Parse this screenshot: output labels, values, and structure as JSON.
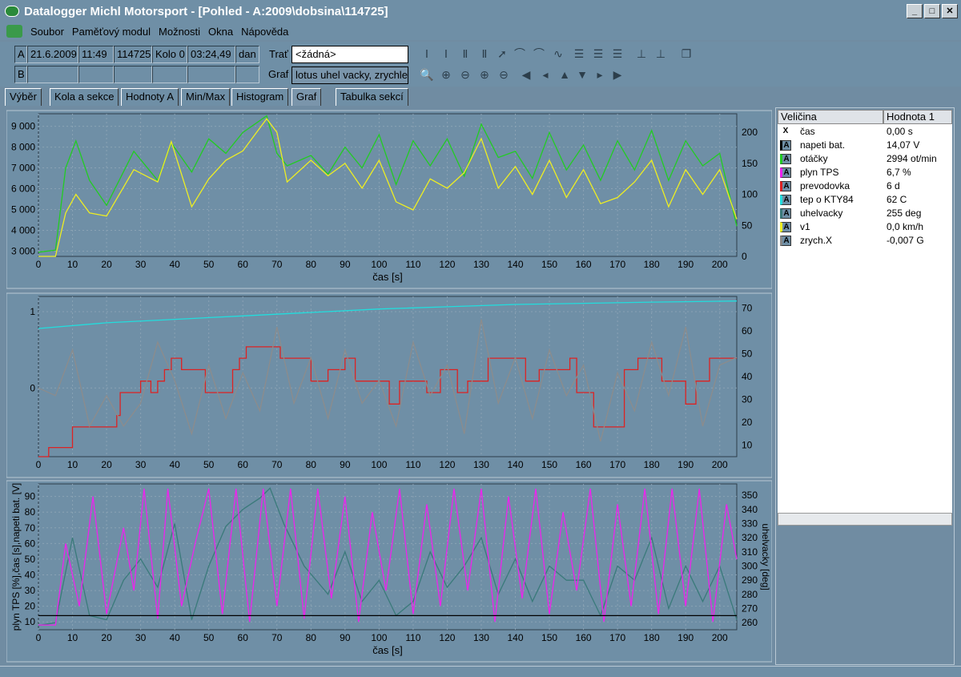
{
  "window": {
    "title": "Datalogger Michl Motorsport - [Pohled - A:2009\\dobsina\\114725]"
  },
  "menu": [
    "Soubor",
    "Paměťový modul",
    "Možnosti",
    "Okna",
    "Nápověda"
  ],
  "toolbar": {
    "rowA": {
      "tag": "A",
      "date": "21.6.2009",
      "time": "11:49",
      "file": "114725",
      "lap": "Kolo 0",
      "laptime": "03:24,49",
      "unit": "dan"
    },
    "rowB": {
      "tag": "B"
    },
    "trat_label": "Trať",
    "trat_value": "<žádná>",
    "graf_label": "Graf",
    "graf_value": "lotus uhel vacky, zrychle"
  },
  "tabs": [
    "Výběr",
    "Kola a sekce",
    "Hodnoty A",
    "Min/Max",
    "Histogram",
    "Graf",
    "Tabulka sekcí"
  ],
  "active_tab": "Graf",
  "channels": {
    "header": {
      "name": "Veličina",
      "value": "Hodnota 1"
    },
    "rows": [
      {
        "swatch": "X",
        "name": "čas",
        "value": "0,00 s",
        "color": "#ffffff"
      },
      {
        "swatch": "A",
        "name": "napeti bat.",
        "value": "14,07 V",
        "color": "#000000"
      },
      {
        "swatch": "A",
        "name": "otáčky",
        "value": "2994 ot/min",
        "color": "#22cc22"
      },
      {
        "swatch": "A",
        "name": "plyn TPS",
        "value": "6,7 %",
        "color": "#ee22ee"
      },
      {
        "swatch": "A",
        "name": "prevodovka",
        "value": "6 d",
        "color": "#dd2222"
      },
      {
        "swatch": "A",
        "name": "tep o KTY84",
        "value": "62 C",
        "color": "#22dddd"
      },
      {
        "swatch": "A",
        "name": "uhelvacky",
        "value": "255 deg",
        "color": "#3a7a7a"
      },
      {
        "swatch": "A",
        "name": "v1",
        "value": "0,0 km/h",
        "color": "#eeee22"
      },
      {
        "swatch": "A",
        "name": "zrych.X",
        "value": "-0,007 G",
        "color": "#888888"
      }
    ]
  },
  "colors": {
    "plot_bg": "#6f8fa6",
    "grid": "#8aa2b4"
  },
  "chart_data": [
    {
      "type": "line",
      "xlabel": "čas [s]",
      "xlim": [
        0,
        205
      ],
      "x_ticks": [
        0,
        10,
        20,
        30,
        40,
        50,
        60,
        70,
        80,
        90,
        100,
        110,
        120,
        130,
        140,
        150,
        160,
        170,
        180,
        190,
        200
      ],
      "y_left_ticks": [
        "3 000",
        "4 000",
        "5 000",
        "6 000",
        "7 000",
        "8 000",
        "9 000"
      ],
      "ylim_left": [
        2750,
        9600
      ],
      "y_right_ticks": [
        "0",
        "50",
        "100",
        "150",
        "200"
      ],
      "ylim_right": [
        0,
        230
      ],
      "series": [
        {
          "name": "otáčky",
          "axis": "left",
          "color": "#22cc22",
          "x": [
            0,
            5,
            8,
            11,
            15,
            20,
            28,
            35,
            39,
            45,
            50,
            55,
            60,
            67,
            70,
            73,
            80,
            85,
            90,
            95,
            100,
            105,
            110,
            115,
            120,
            125,
            130,
            135,
            140,
            145,
            150,
            155,
            160,
            165,
            170,
            175,
            180,
            185,
            190,
            195,
            200,
            205
          ],
          "y": [
            2950,
            3050,
            7000,
            8300,
            6400,
            5200,
            7800,
            6400,
            8200,
            6800,
            8400,
            7700,
            8700,
            9500,
            7700,
            7100,
            7600,
            6700,
            8000,
            7000,
            8600,
            6200,
            8300,
            7100,
            8400,
            6600,
            9100,
            7500,
            7800,
            6500,
            8700,
            6900,
            8100,
            6400,
            8300,
            6900,
            8800,
            6400,
            8300,
            7100,
            7700,
            4200
          ]
        },
        {
          "name": "v1",
          "axis": "right",
          "color": "#eeee22",
          "x": [
            0,
            5,
            8,
            11,
            15,
            20,
            28,
            35,
            39,
            45,
            50,
            55,
            60,
            67,
            70,
            73,
            80,
            85,
            90,
            95,
            100,
            105,
            110,
            115,
            120,
            125,
            130,
            135,
            140,
            145,
            150,
            155,
            160,
            165,
            170,
            175,
            180,
            185,
            190,
            195,
            200,
            205
          ],
          "y": [
            0,
            0,
            70,
            100,
            70,
            65,
            140,
            120,
            185,
            80,
            125,
            155,
            170,
            222,
            200,
            120,
            155,
            130,
            150,
            110,
            155,
            88,
            75,
            125,
            110,
            135,
            190,
            110,
            145,
            100,
            155,
            95,
            140,
            85,
            95,
            120,
            155,
            80,
            140,
            100,
            140,
            60
          ]
        }
      ]
    },
    {
      "type": "line",
      "xlim": [
        0,
        205
      ],
      "x_ticks": [
        0,
        10,
        20,
        30,
        40,
        50,
        60,
        70,
        80,
        90,
        100,
        110,
        120,
        130,
        140,
        150,
        160,
        170,
        180,
        190,
        200
      ],
      "y_left_ticks": [
        "0",
        "1"
      ],
      "ylim_left": [
        -0.9,
        1.2
      ],
      "y_right_ticks": [
        "10",
        "20",
        "30",
        "40",
        "50",
        "60",
        "70"
      ],
      "ylim_right": [
        5,
        75
      ],
      "series": [
        {
          "name": "tep o KTY84",
          "axis": "right",
          "color": "#22dddd",
          "x": [
            0,
            20,
            40,
            60,
            80,
            100,
            120,
            140,
            160,
            180,
            205
          ],
          "y": [
            61,
            63.5,
            65,
            66.5,
            68,
            69.5,
            70.5,
            71.5,
            72,
            72.5,
            73
          ]
        },
        {
          "name": "prevodovka",
          "axis": "right",
          "color": "#dd2222",
          "x": [
            0,
            3,
            3,
            10,
            10,
            20,
            20,
            23,
            23,
            24,
            24,
            30,
            30,
            33,
            33,
            35,
            35,
            37,
            37,
            39,
            39,
            42,
            42,
            49,
            49,
            57,
            57,
            59,
            59,
            61,
            61,
            71,
            71,
            80,
            80,
            85,
            85,
            90,
            90,
            93,
            93,
            103,
            103,
            106,
            106,
            114,
            114,
            118,
            118,
            123,
            123,
            126,
            126,
            132,
            132,
            143,
            143,
            147,
            147,
            156,
            156,
            158,
            158,
            163,
            163,
            172,
            172,
            176,
            176,
            183,
            183,
            190,
            190,
            193,
            193,
            197,
            197,
            205
          ],
          "y": [
            5,
            5,
            9,
            9,
            18,
            18,
            18,
            18,
            23,
            23,
            33,
            33,
            38,
            38,
            33,
            33,
            38,
            38,
            43,
            43,
            48,
            48,
            43,
            43,
            33,
            33,
            43,
            43,
            48,
            48,
            53,
            53,
            48,
            48,
            38,
            38,
            43,
            43,
            48,
            48,
            38,
            38,
            28,
            28,
            38,
            38,
            33,
            33,
            43,
            43,
            33,
            33,
            38,
            38,
            48,
            48,
            38,
            38,
            43,
            43,
            48,
            48,
            33,
            33,
            18,
            18,
            43,
            43,
            48,
            48,
            38,
            38,
            28,
            28,
            38,
            38,
            48,
            48
          ]
        },
        {
          "name": "zrych.X",
          "axis": "left",
          "color": "#8c8c8c",
          "x": [
            0,
            5,
            10,
            15,
            20,
            25,
            30,
            35,
            40,
            45,
            50,
            55,
            60,
            65,
            70,
            75,
            80,
            85,
            90,
            95,
            100,
            105,
            110,
            115,
            120,
            125,
            130,
            135,
            140,
            145,
            150,
            155,
            160,
            165,
            170,
            175,
            180,
            185,
            190,
            195,
            200,
            205
          ],
          "y": [
            0,
            -0.1,
            0.5,
            -0.5,
            -0.1,
            -0.5,
            -0.2,
            0.6,
            0.1,
            -0.6,
            0.3,
            -0.4,
            0.2,
            -0.3,
            0.8,
            -0.2,
            0.4,
            -0.4,
            0.5,
            -0.2,
            0.1,
            -0.5,
            0.6,
            -0.1,
            0.3,
            -0.6,
            0.9,
            -0.2,
            0.4,
            -0.4,
            0.5,
            -0.1,
            0.3,
            -0.7,
            0.2,
            -0.3,
            0.6,
            -0.1,
            0.8,
            -0.5,
            0.3,
            0.4
          ]
        }
      ]
    },
    {
      "type": "line",
      "xlabel": "čas [s]",
      "xlim": [
        0,
        205
      ],
      "x_ticks": [
        0,
        10,
        20,
        30,
        40,
        50,
        60,
        70,
        80,
        90,
        100,
        110,
        120,
        130,
        140,
        150,
        160,
        170,
        180,
        190,
        200
      ],
      "ylabel_left": "plyn TPS [%],čas [s],napeti bat. [V]",
      "ylabel_right": "uhelvacky [deg]",
      "y_left_ticks": [
        "10",
        "20",
        "30",
        "40",
        "50",
        "60",
        "70",
        "80",
        "90"
      ],
      "ylim_left": [
        5,
        98
      ],
      "y_right_ticks": [
        "260",
        "270",
        "280",
        "290",
        "300",
        "310",
        "320",
        "330",
        "340",
        "350"
      ],
      "ylim_right": [
        255,
        358
      ],
      "series": [
        {
          "name": "uhelvacky",
          "axis": "right",
          "color": "#3a7a7a",
          "x": [
            0,
            5,
            10,
            15,
            20,
            25,
            30,
            35,
            40,
            45,
            50,
            55,
            60,
            65,
            68,
            72,
            78,
            85,
            90,
            95,
            100,
            105,
            110,
            115,
            120,
            125,
            130,
            135,
            140,
            145,
            150,
            155,
            160,
            165,
            170,
            175,
            180,
            185,
            190,
            195,
            200,
            205
          ],
          "y": [
            258,
            260,
            320,
            265,
            262,
            290,
            305,
            285,
            330,
            262,
            300,
            328,
            340,
            348,
            355,
            330,
            300,
            280,
            310,
            275,
            290,
            265,
            275,
            310,
            285,
            300,
            320,
            280,
            305,
            275,
            300,
            290,
            290,
            265,
            300,
            290,
            320,
            270,
            300,
            275,
            300,
            262
          ]
        },
        {
          "name": "plyn TPS",
          "axis": "left",
          "color": "#ee22ee",
          "x": [
            0,
            5,
            8,
            12,
            16,
            20,
            25,
            28,
            31,
            35,
            38,
            42,
            46,
            50,
            54,
            58,
            62,
            66,
            70,
            74,
            78,
            82,
            86,
            90,
            94,
            98,
            102,
            106,
            110,
            114,
            118,
            122,
            126,
            130,
            134,
            138,
            142,
            146,
            150,
            154,
            158,
            162,
            166,
            170,
            174,
            178,
            182,
            186,
            190,
            194,
            198,
            202,
            205
          ],
          "y": [
            8,
            8,
            60,
            20,
            90,
            15,
            70,
            30,
            95,
            12,
            95,
            20,
            60,
            95,
            15,
            95,
            10,
            95,
            20,
            95,
            12,
            95,
            25,
            90,
            10,
            80,
            30,
            95,
            15,
            85,
            20,
            95,
            30,
            95,
            10,
            90,
            25,
            95,
            15,
            80,
            30,
            95,
            10,
            85,
            20,
            95,
            15,
            95,
            20,
            95,
            10,
            85,
            50
          ]
        },
        {
          "name": "napeti bat.",
          "axis": "left",
          "color": "#000000",
          "x": [
            0,
            205
          ],
          "y": [
            14,
            14
          ]
        }
      ]
    }
  ]
}
